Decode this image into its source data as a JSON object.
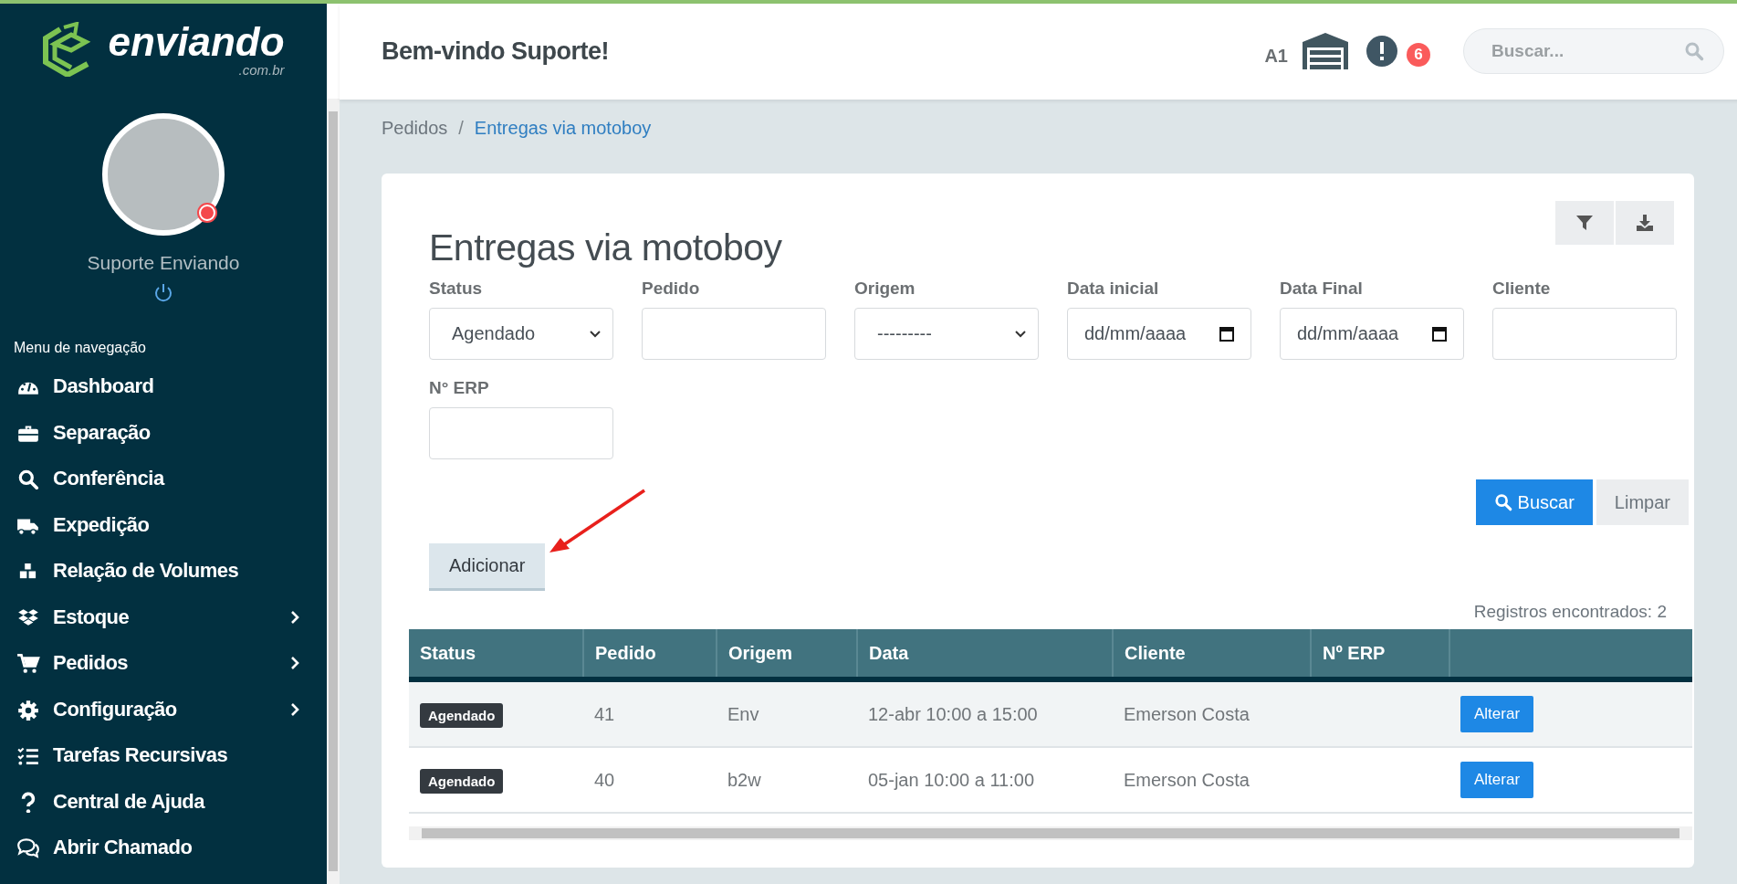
{
  "sidebar": {
    "logo": {
      "name": "enviando",
      "domain": ".com.br"
    },
    "user": {
      "name": "Suporte Enviando"
    },
    "menu_title": "Menu de navegação",
    "items": [
      {
        "label": "Dashboard",
        "expandable": false
      },
      {
        "label": "Separação",
        "expandable": false
      },
      {
        "label": "Conferência",
        "expandable": false
      },
      {
        "label": "Expedição",
        "expandable": false
      },
      {
        "label": "Relação de Volumes",
        "expandable": false
      },
      {
        "label": "Estoque",
        "expandable": true
      },
      {
        "label": "Pedidos",
        "expandable": true
      },
      {
        "label": "Configuração",
        "expandable": true
      },
      {
        "label": "Tarefas Recursivas",
        "expandable": false
      },
      {
        "label": "Central de Ajuda",
        "expandable": false
      },
      {
        "label": "Abrir Chamado",
        "expandable": false
      }
    ]
  },
  "header": {
    "greeting": "Bem-vindo Suporte!",
    "store_code": "A1",
    "notification_count": "6",
    "search": {
      "placeholder": "Buscar..."
    }
  },
  "breadcrumb_separator": "/",
  "breadcrumb": [
    {
      "label": "Pedidos",
      "current": false
    },
    {
      "label": "Entregas via motoboy",
      "current": true
    }
  ],
  "page": {
    "title": "Entregas via motoboy",
    "filters": [
      {
        "label": "Status",
        "kind": "select",
        "value": "Agendado"
      },
      {
        "label": "Pedido",
        "kind": "text"
      },
      {
        "label": "Origem",
        "kind": "select",
        "value": "---------"
      },
      {
        "label": "Data inicial",
        "kind": "date",
        "value": "dd/mm/aaaa"
      },
      {
        "label": "Data Final",
        "kind": "date",
        "value": "dd/mm/aaaa"
      },
      {
        "label": "Cliente",
        "kind": "text"
      },
      {
        "label": "N° ERP",
        "kind": "text"
      }
    ],
    "search_button": "Buscar",
    "clear_button": "Limpar",
    "add_button": "Adicionar",
    "records": "Registros encontrados: 2",
    "table": {
      "columns": [
        "Status",
        "Pedido",
        "Origem",
        "Data",
        "Cliente",
        "Nº ERP"
      ],
      "rows": [
        {
          "status": "Agendado",
          "pedido": "41",
          "origem": "Env",
          "data": "12-abr 10:00 a 15:00",
          "cliente": "Emerson Costa",
          "action": "Alterar"
        },
        {
          "status": "Agendado",
          "pedido": "40",
          "origem": "b2w",
          "data": "05-jan 10:00 a 11:00",
          "cliente": "Emerson Costa",
          "action": "Alterar"
        }
      ]
    }
  }
}
